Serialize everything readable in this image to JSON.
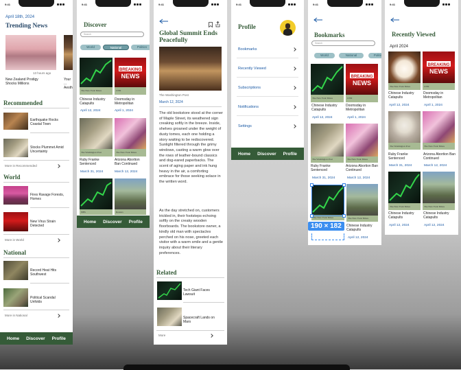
{
  "status_time": "9:41",
  "tabbar": [
    "Home",
    "Discover",
    "Profile"
  ],
  "home": {
    "date": "April 18th, 2024",
    "trending_title": "Trending News",
    "trending": [
      {
        "caption": "New Zealand Prodigy Shocks Millions",
        "time": "13 hours ago"
      },
      {
        "caption": "Your ... Aesth...",
        "time": ""
      }
    ],
    "sections": [
      {
        "title": "Recommended",
        "items": [
          "Earthquake Rocks Coastal Town",
          "Stocks Plummet Amid Uncertainty"
        ],
        "more": "More in Recommended"
      },
      {
        "title": "World",
        "items": [
          "Fires Ravage Forests, Homes",
          "New Virus Strain Detected"
        ],
        "more": "More in World"
      },
      {
        "title": "National",
        "items": [
          "Record Heat Hits Southwest",
          "Political Scandal Unfolds"
        ],
        "more": "More in National"
      }
    ]
  },
  "discover": {
    "title": "Discover",
    "search_placeholder": "Search",
    "pills": [
      "World",
      "National",
      "Politics"
    ],
    "cards": [
      {
        "source": "The New York Times",
        "caption": "Chinese Industry Catapults",
        "date": "April 12, 2024"
      },
      {
        "source": "CNN",
        "caption": "Doomsday in Metropolitan",
        "date": "April 1, 2024"
      },
      {
        "source": "The Washington Post",
        "caption": "Ruby Franke Sentenced",
        "date": "March 31, 2024"
      },
      {
        "source": "The New York Times",
        "caption": "Arizona Abortion Ban Continued",
        "date": "March 12, 2024"
      },
      {
        "source": "NBS",
        "caption": "",
        "date": ""
      },
      {
        "source": "Reuters",
        "caption": "",
        "date": ""
      }
    ]
  },
  "article": {
    "title": "Global Summit Ends Peacefully",
    "source": "The Washington Post",
    "date": "March 12, 2024",
    "para1": "The old bookstore stood at the corner of Maple Street, its weathered sign creaking softly in the breeze. Inside, shelves groaned under the weight of dusty tomes, each one holding a story waiting to be rediscovered. Sunlight filtered through the grimy windows, casting a warm glow over the rows of leather-bound classics and dog-eared paperbacks. The scent of aging paper and ink hung heavy in the air, a comforting embrace for those seeking solace in the written word.",
    "para2": "As the day stretched on, customers trickled in, their footsteps echoing softly on the creaky wooden floorboards. The bookstore owner, a kindly old man with spectacles perched on his nose, greeted each visitor with a warm smile and a gentle inquiry about their literary preferences.",
    "related_title": "Related",
    "related": [
      "Tech Giant Faces Lawsuit",
      "Spacecraft Lands on Mars"
    ],
    "more": "More"
  },
  "profile": {
    "title": "Profile",
    "items": [
      "Bookmarks",
      "Recently Viewed",
      "Subscriptions",
      "Notifications",
      "Settings"
    ]
  },
  "bookmarks": {
    "title": "Bookmarks",
    "search_placeholder": "Search",
    "pills": [
      "World",
      "National",
      "Politics"
    ],
    "cards": [
      {
        "source": "The New York Times",
        "caption": "Chinese Industry Catapults",
        "date": "April 12, 2024"
      },
      {
        "source": "CNN",
        "caption": "Doomsday in Metropolitan",
        "date": "April 1, 2024"
      },
      {
        "source": "The Washington Post",
        "caption": "Ruby Franke Sentenced",
        "date": "March 31, 2024"
      },
      {
        "source": "The New York Times",
        "caption": "Arizona Abortion Ban Continued",
        "date": "March 12, 2024"
      },
      {
        "source": "The New York Times",
        "caption": "",
        "date": ""
      },
      {
        "source": "The New York Times",
        "caption": "Chinese Industry Catapults",
        "date": "April 12, 2024"
      }
    ],
    "selection_size": "190 × 182"
  },
  "recent": {
    "title": "Recently Viewed",
    "month": "April 2024",
    "cards": [
      {
        "source": "The New York Times",
        "caption": "Chinese Industry Catapults",
        "date": "April 12, 2024"
      },
      {
        "source": "CNN",
        "caption": "Doomsday in Metropolitan",
        "date": "April 1, 2024"
      },
      {
        "source": "The Washington Post",
        "caption": "Ruby Franke Sentenced",
        "date": "March 31, 2024"
      },
      {
        "source": "The New York Times",
        "caption": "Arizona Abortion Ban Continued",
        "date": "March 12, 2024"
      },
      {
        "source": "The New York Times",
        "caption": "Chinese Industry Catapults",
        "date": "April 12, 2024"
      },
      {
        "source": "The New York Times",
        "caption": "Chinese Industry Catapults",
        "date": "April 12, 2024"
      }
    ]
  },
  "colors": {
    "brand_green": "#355b38",
    "link_blue": "#1b5aa5",
    "selection_blue": "#2f7de1"
  }
}
